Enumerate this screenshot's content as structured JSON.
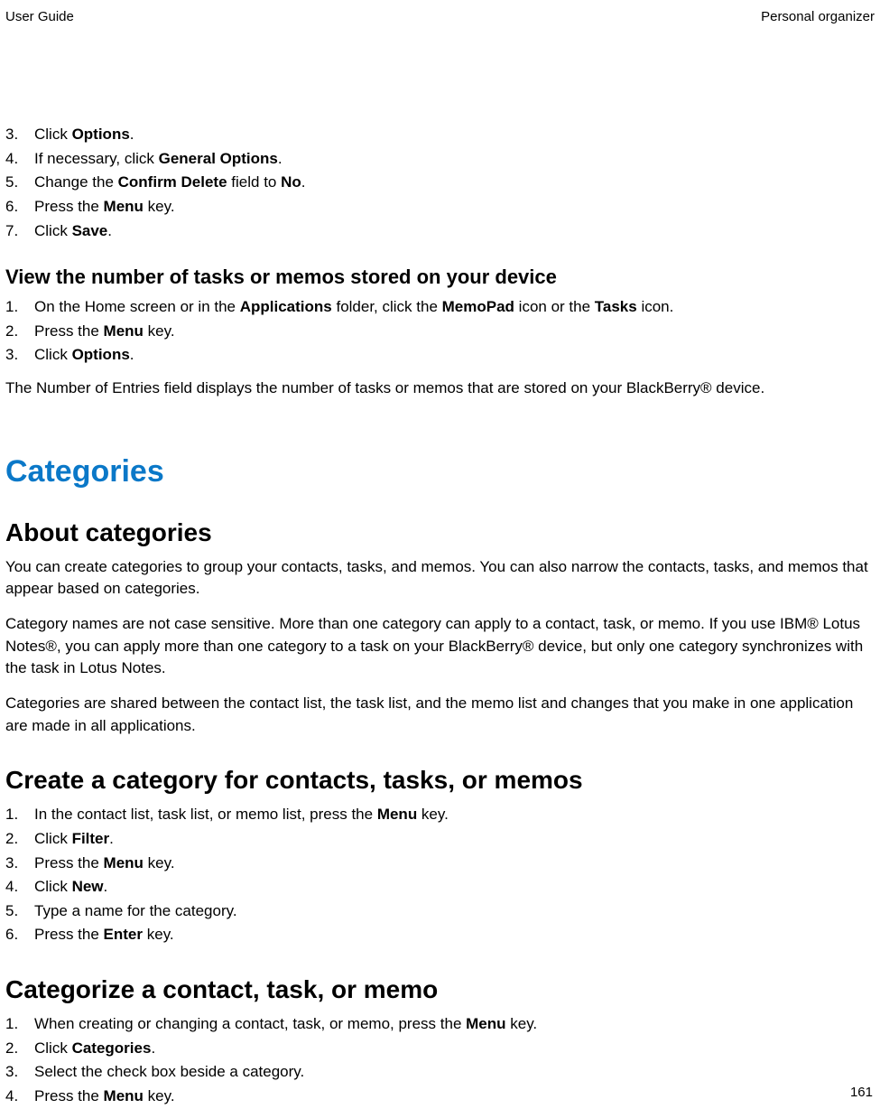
{
  "header": {
    "left": "User Guide",
    "right": "Personal organizer"
  },
  "list1": [
    {
      "num": "3.",
      "pre": "Click ",
      "bold": "Options",
      "post": "."
    },
    {
      "num": "4.",
      "pre": "If necessary, click ",
      "bold": "General Options",
      "post": "."
    },
    {
      "num": "5.",
      "pre": "Change the ",
      "bold": "Confirm Delete",
      "post2": " field to ",
      "bold2": "No",
      "post": "."
    },
    {
      "num": "6.",
      "pre": "Press the ",
      "bold": "Menu",
      "post": " key."
    },
    {
      "num": "7.",
      "pre": "Click ",
      "bold": "Save",
      "post": "."
    }
  ],
  "h3a": "View the number of tasks or memos stored on your device",
  "list2": [
    {
      "num": "1.",
      "pre": "On the Home screen or in the ",
      "bold": "Applications",
      "post2": " folder, click the ",
      "bold2": "MemoPad",
      "post3": " icon or the ",
      "bold3": "Tasks",
      "post": " icon."
    },
    {
      "num": "2.",
      "pre": "Press the ",
      "bold": "Menu",
      "post": " key."
    },
    {
      "num": "3.",
      "pre": "Click ",
      "bold": "Options",
      "post": "."
    }
  ],
  "para1": "The Number of Entries field displays the number of tasks or memos that are stored on your BlackBerry® device.",
  "h1": "Categories",
  "h2a": "About categories",
  "para2": "You can create categories to group your contacts, tasks, and memos. You can also narrow the contacts, tasks, and memos that appear based on categories.",
  "para3": "Category names are not case sensitive. More than one category can apply to a contact, task, or memo. If you use IBM® Lotus Notes®, you can apply more than one category to a task on your BlackBerry® device, but only one category synchronizes with the task in Lotus Notes.",
  "para4": "Categories are shared between the contact list, the task list, and the memo list and changes that you make in one application are made in all applications.",
  "h2b": "Create a category for contacts, tasks, or memos",
  "list3": [
    {
      "num": "1.",
      "pre": "In the contact list, task list, or memo list, press the ",
      "bold": "Menu",
      "post": " key."
    },
    {
      "num": "2.",
      "pre": "Click ",
      "bold": "Filter",
      "post": "."
    },
    {
      "num": "3.",
      "pre": "Press the ",
      "bold": "Menu",
      "post": " key."
    },
    {
      "num": "4.",
      "pre": "Click ",
      "bold": "New",
      "post": "."
    },
    {
      "num": "5.",
      "pre": "Type a name for the category."
    },
    {
      "num": "6.",
      "pre": "Press the ",
      "bold": "Enter",
      "post": " key."
    }
  ],
  "h2c": "Categorize a contact, task, or memo",
  "list4": [
    {
      "num": "1.",
      "pre": "When creating or changing a contact, task, or memo, press the ",
      "bold": "Menu",
      "post": " key."
    },
    {
      "num": "2.",
      "pre": "Click ",
      "bold": "Categories",
      "post": "."
    },
    {
      "num": "3.",
      "pre": "Select the check box beside a category."
    },
    {
      "num": "4.",
      "pre": "Press the ",
      "bold": "Menu",
      "post": " key."
    }
  ],
  "page": "161"
}
